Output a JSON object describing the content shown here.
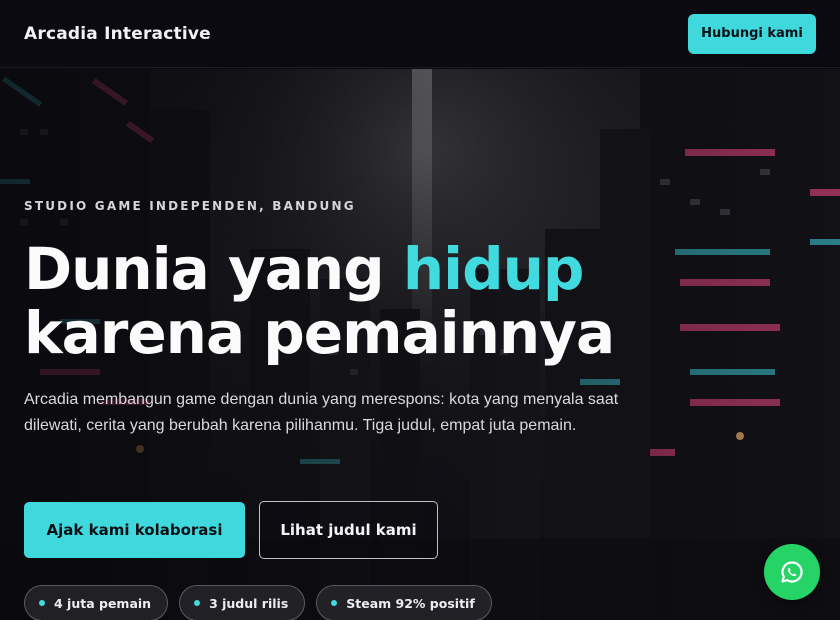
{
  "header": {
    "brand": "Arcadia Interactive",
    "contact_label": "Hubungi kami"
  },
  "hero": {
    "eyebrow": "STUDIO GAME INDEPENDEN, BANDUNG",
    "headline_part1": "Dunia yang ",
    "headline_accent": "hidup",
    "headline_line2": "karena pemainnya",
    "lede": "Arcadia membangun game dengan dunia yang merespons: kota yang menyala saat dilewati, cerita yang berubah karena pilihanmu. Tiga judul, empat juta pemain.",
    "primary_cta": "Ajak kami kolaborasi",
    "secondary_cta": "Lihat judul kami",
    "stats": [
      "4 juta pemain",
      "3 judul rilis",
      "Steam 92% positif"
    ]
  },
  "floating": {
    "icon": "whatsapp-icon"
  },
  "colors": {
    "accent": "#41dadf",
    "background": "#0b0a10",
    "neon_pink": "#e0457a",
    "neon_cyan": "#3fc9d6",
    "whatsapp": "#25d366"
  }
}
